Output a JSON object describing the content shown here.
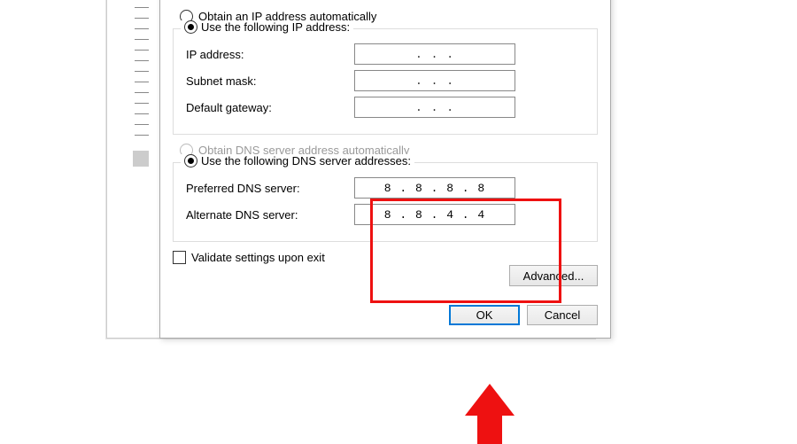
{
  "ip_section": {
    "auto_label": "Obtain an IP address automatically",
    "manual_label": "Use the following IP address:",
    "ip_label": "IP address:",
    "ip_value": ".       .       .",
    "subnet_label": "Subnet mask:",
    "subnet_value": ".       .       .",
    "gateway_label": "Default gateway:",
    "gateway_value": ".       .       ."
  },
  "dns_section": {
    "auto_label": "Obtain DNS server address automatically",
    "manual_label": "Use the following DNS server addresses:",
    "preferred_label": "Preferred DNS server:",
    "preferred_value": "8  .  8  .  8  .  8",
    "alternate_label": "Alternate DNS server:",
    "alternate_value": "8  .  8  .  4  .  4"
  },
  "validate_label": "Validate settings upon exit",
  "advanced_label": "Advanced...",
  "ok_label": "OK",
  "cancel_label": "Cancel"
}
